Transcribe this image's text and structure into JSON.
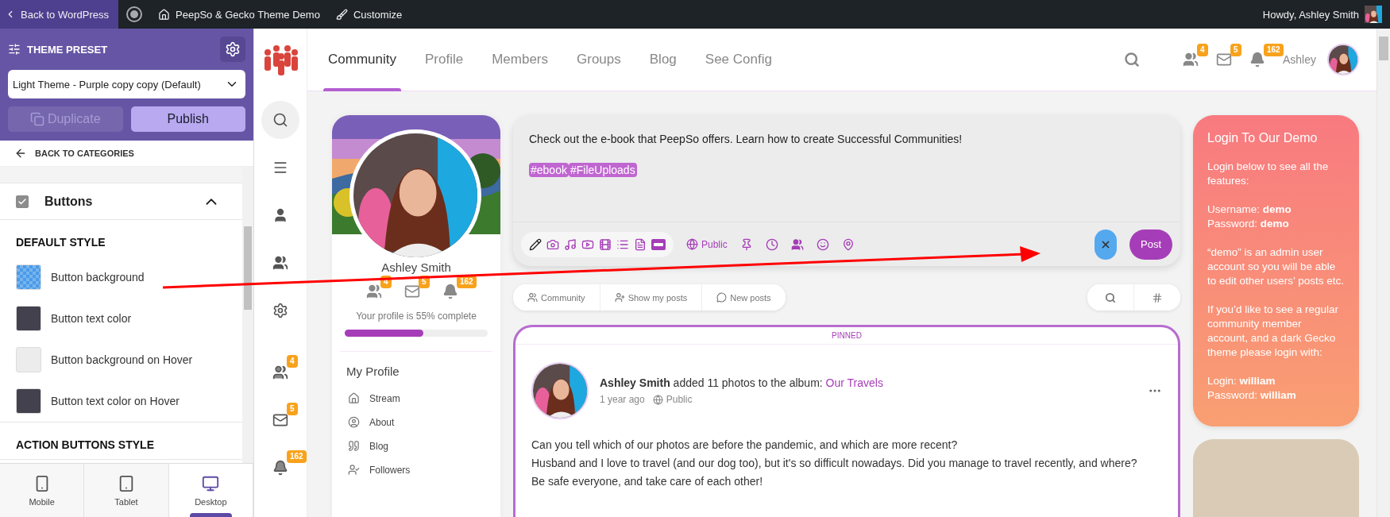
{
  "admin_bar": {
    "back": "Back to WordPress",
    "site": "PeepSo & Gecko Theme Demo",
    "customize": "Customize",
    "howdy": "Howdy, Ashley Smith"
  },
  "customizer": {
    "title": "THEME PRESET",
    "preset": "Light Theme - Purple copy copy (Default)",
    "actions": [
      {
        "label": "Duplicate",
        "disabled": true
      },
      {
        "label": "Publish",
        "disabled": false
      }
    ],
    "back": "BACK TO CATEGORIES",
    "section": {
      "title": "Buttons",
      "checked": true,
      "expanded": true
    },
    "groups": [
      {
        "title": "DEFAULT STYLE",
        "options": [
          {
            "label": "Button background",
            "kind": "pattern",
            "color": "#4a9be8"
          },
          {
            "label": "Button text color",
            "kind": "solid",
            "color": "#42414d"
          },
          {
            "label": "Button background on Hover",
            "kind": "solid",
            "color": "#ececec"
          },
          {
            "label": "Button text color on Hover",
            "kind": "solid",
            "color": "#42414d"
          }
        ]
      },
      {
        "title": "ACTION BUTTONS STYLE"
      }
    ],
    "devices": [
      {
        "label": "Mobile",
        "kind": "mobile",
        "selected": false
      },
      {
        "label": "Tablet",
        "kind": "tablet",
        "selected": false
      },
      {
        "label": "Desktop",
        "kind": "desktop",
        "selected": true
      }
    ]
  },
  "rail": [
    {
      "kind": "search"
    },
    {
      "kind": "menu"
    },
    {
      "kind": "user"
    },
    {
      "kind": "group"
    },
    {
      "kind": "settings"
    },
    {
      "kind": "friends",
      "badge": "4"
    },
    {
      "kind": "messages",
      "badge": "5"
    },
    {
      "kind": "notifications",
      "badge": "162"
    }
  ],
  "nav": {
    "tabs": [
      {
        "label": "Community",
        "selected": true
      },
      {
        "label": "Profile",
        "selected": false
      },
      {
        "label": "Members",
        "selected": false
      },
      {
        "label": "Groups",
        "selected": false
      },
      {
        "label": "Blog",
        "selected": false
      },
      {
        "label": "See Config",
        "selected": false
      }
    ],
    "notifications": [
      {
        "kind": "friends",
        "count": "4"
      },
      {
        "kind": "messages",
        "count": "5"
      },
      {
        "kind": "notifications",
        "count": "162"
      }
    ],
    "user": "Ashley"
  },
  "profile": {
    "name": "Ashley Smith",
    "counts": [
      {
        "kind": "friends",
        "count": "4"
      },
      {
        "kind": "messages",
        "count": "5"
      },
      {
        "kind": "notifications",
        "count": "162"
      }
    ],
    "completeness": "Your profile is 55% complete",
    "level": 0.55,
    "menu_title": "My Profile",
    "menu": [
      {
        "kind": "home",
        "label": "Stream"
      },
      {
        "kind": "about",
        "label": "About"
      },
      {
        "kind": "quote",
        "label": "Blog"
      },
      {
        "kind": "followers",
        "label": "Followers"
      }
    ]
  },
  "composer": {
    "text": "Check out the e-book that PeepSo offers. Learn how to create Successful Communities!",
    "tags": [
      "#ebook",
      "#FileUploads"
    ],
    "privacy": "Public",
    "post": "Post"
  },
  "filters": [
    {
      "kind": "community",
      "label": "Community"
    },
    {
      "kind": "mine",
      "label": "Show my posts"
    },
    {
      "kind": "new",
      "label": "New posts"
    }
  ],
  "post": {
    "badge": "PINNED",
    "author": "Ashley Smith",
    "action": "added 11 photos to the album:",
    "album": "Our Travels",
    "time": "1 year ago",
    "privacy": "Public",
    "body": [
      "Can you tell which of our photos are before the pandemic, and which are more recent?",
      "Husband and I love to travel (and our dog too), but it's so difficult nowadays. Did you manage to travel recently, and where?",
      "Be safe everyone, and take care of each other!"
    ]
  },
  "promo": {
    "title": "Login To Our Demo",
    "paragraphs": [
      [
        "Login below to see all the features:"
      ],
      [
        "Username: **demo**",
        "Password: **demo**"
      ],
      [
        "“demo” is an admin user account so you will be able to edit other users’ posts etc."
      ],
      [
        "If you’d like to see a regular community member account, and a dark Gecko theme please login with:"
      ],
      [
        "Login: **william**",
        "Password: **william**"
      ]
    ]
  }
}
